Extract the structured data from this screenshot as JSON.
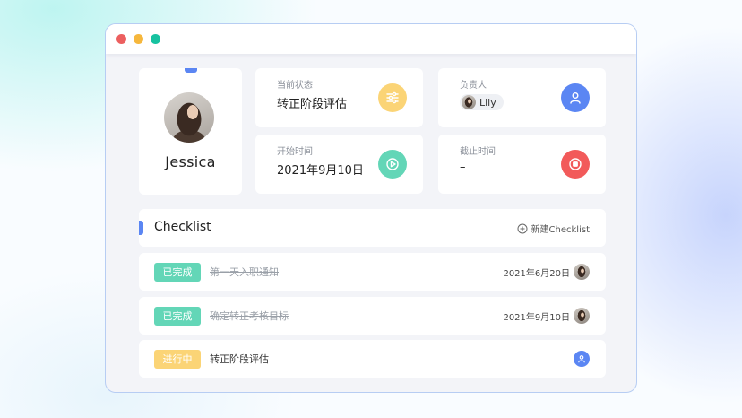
{
  "profile": {
    "name": "Jessica"
  },
  "status": {
    "label": "当前状态",
    "value": "转正阶段评估",
    "icon": "sliders-icon",
    "color": "#fbd476"
  },
  "owner": {
    "label": "负责人",
    "name": "Lily",
    "icon": "user-icon",
    "color": "#5b86f3"
  },
  "start": {
    "label": "开始时间",
    "value": "2021年9月10日",
    "icon": "play-icon",
    "color": "#63d6b7"
  },
  "deadline": {
    "label": "截止时间",
    "value": "–",
    "icon": "stop-icon",
    "color": "#f25a5a"
  },
  "checklist": {
    "title": "Checklist",
    "new_label": "新建Checklist",
    "tasks": [
      {
        "status": "已完成",
        "title": "第一天入职通知",
        "date": "2021年6月20日",
        "done": true
      },
      {
        "status": "已完成",
        "title": "确定转正考核目标",
        "date": "2021年9月10日",
        "done": true
      },
      {
        "status": "进行中",
        "title": "转正阶段评估",
        "date": "",
        "done": false
      }
    ]
  }
}
